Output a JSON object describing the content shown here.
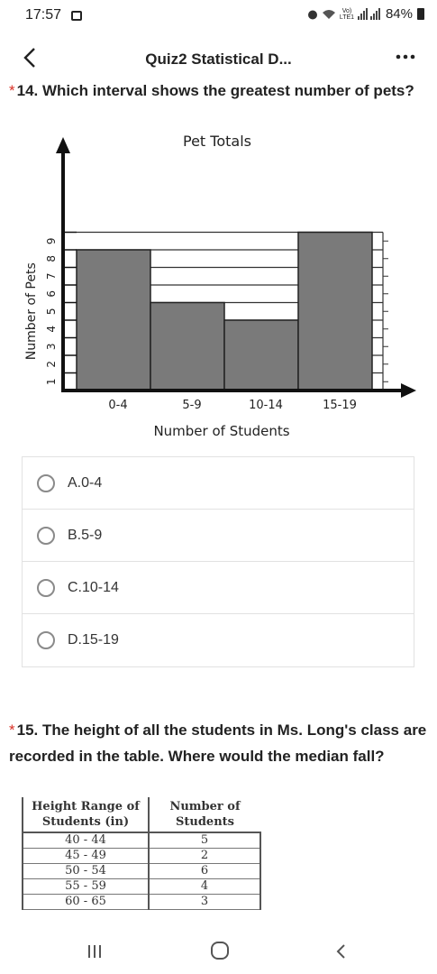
{
  "status": {
    "time": "17:57",
    "network": "Vo) LTE1",
    "battery": "84%"
  },
  "app_bar": {
    "title": "Quiz2 Statistical D..."
  },
  "q14": {
    "star": "*",
    "text": "14. Which interval shows the greatest number of pets?"
  },
  "chart_data": {
    "type": "bar",
    "title": "Pet Totals",
    "xlabel": "Number of Students",
    "ylabel": "Number of Pets",
    "categories": [
      "0-4",
      "5-9",
      "10-14",
      "15-19"
    ],
    "values": [
      8,
      5,
      4,
      9
    ],
    "yticks": [
      1,
      2,
      3,
      4,
      5,
      6,
      7,
      8,
      9
    ],
    "ylim": [
      0,
      9
    ],
    "grid": true
  },
  "options": [
    {
      "label": "A.0-4"
    },
    {
      "label": "B.5-9"
    },
    {
      "label": "C.10-14"
    },
    {
      "label": "D.15-19"
    }
  ],
  "q15": {
    "star": "*",
    "text": "15. The height of all the students in Ms. Long's class are recorded in the table. Where would the median fall?"
  },
  "height_table": {
    "headers": [
      "Height Range of Students (in)",
      "Number of Students"
    ],
    "rows": [
      [
        "40 - 44",
        "5"
      ],
      [
        "45 - 49",
        "2"
      ],
      [
        "50 - 54",
        "6"
      ],
      [
        "55 - 59",
        "4"
      ],
      [
        "60 - 65",
        "3"
      ]
    ]
  },
  "nav": {
    "recents_icon": "recents-icon",
    "home_icon": "home-icon",
    "back_icon": "back-icon"
  }
}
